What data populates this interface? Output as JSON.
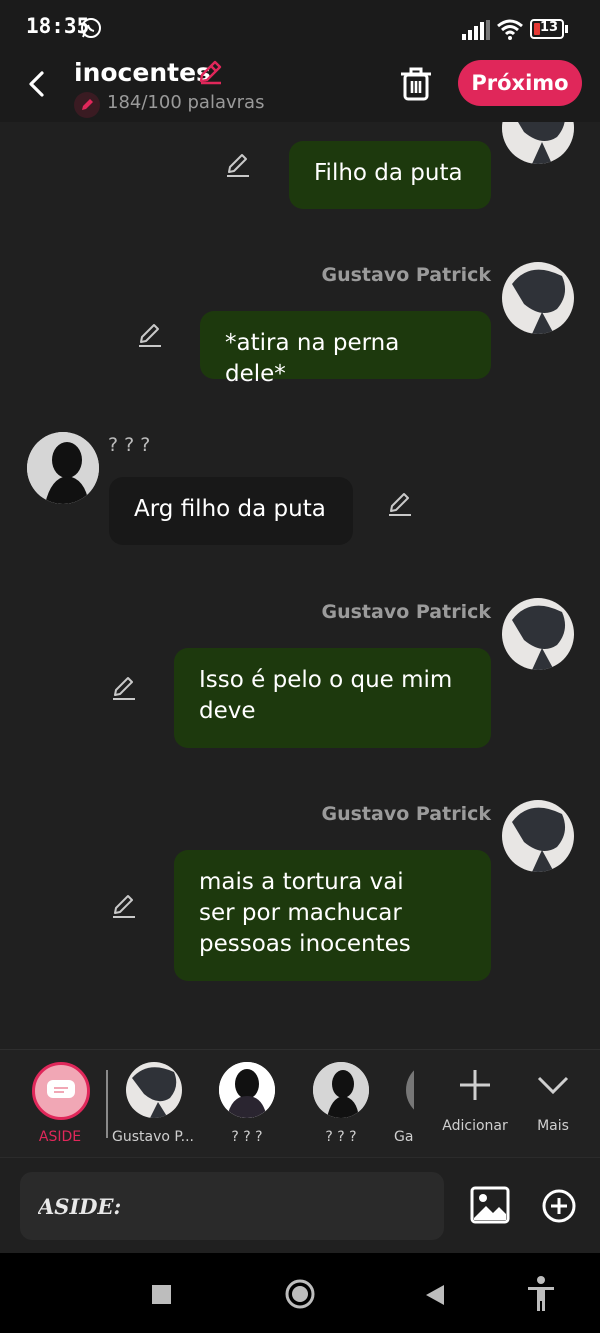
{
  "status": {
    "time": "18:35",
    "battery": "13"
  },
  "header": {
    "title": "inocentes",
    "word_count": "184/100 palavras",
    "next_label": "Próximo"
  },
  "messages": [
    {
      "sender": "",
      "text": "Filho da puta"
    },
    {
      "sender": "Gustavo Patrick",
      "text": "*atira na perna dele*"
    },
    {
      "sender": "? ? ?",
      "text": "Arg filho da puta"
    },
    {
      "sender": "Gustavo Patrick",
      "text_lines": [
        "Isso é pelo o que mim",
        "deve"
      ]
    },
    {
      "sender": "Gustavo Patrick",
      "text_lines": [
        "mais a tortura vai",
        "ser por machucar",
        "pessoas inocentes"
      ]
    }
  ],
  "characters": [
    {
      "label": "ASIDE"
    },
    {
      "label": "Gustavo P..."
    },
    {
      "label": "? ? ?"
    },
    {
      "label": "? ? ?"
    },
    {
      "label": "Gal"
    },
    {
      "label": "Adicionar"
    },
    {
      "label": "Mais"
    }
  ],
  "composer": {
    "placeholder": "ASIDE:"
  },
  "colors": {
    "accent": "#e0275a",
    "own_bubble": "#1d390d",
    "other_bubble": "#181818"
  }
}
